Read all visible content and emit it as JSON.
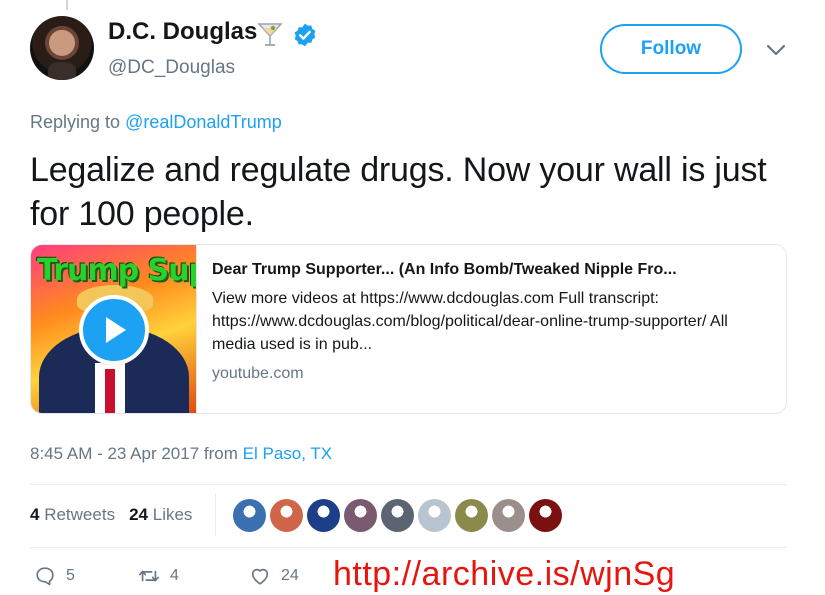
{
  "author": {
    "display_name": "D.C. Douglas",
    "handle": "@DC_Douglas",
    "emoji_icon": "cocktail-glass-icon",
    "verified_icon": "verified-badge-icon"
  },
  "header": {
    "follow_label": "Follow",
    "caret_icon": "chevron-down-icon"
  },
  "reply": {
    "prefix": "Replying to",
    "target": "@realDonaldTrump"
  },
  "tweet": {
    "text": "Legalize and regulate drugs. Now your wall is just for 100 people."
  },
  "card": {
    "thumbnail_text": "Trump Suppo",
    "title": "Dear Trump Supporter... (An Info Bomb/Tweaked Nipple Fro...",
    "description": "View more videos at https://www.dcdouglas.com Full transcript: https://www.dcdouglas.com/blog/political/dear-online-trump-supporter/ All media used is in pub...",
    "domain": "youtube.com",
    "play_icon": "play-icon"
  },
  "meta": {
    "time": "8:45 AM - 23 Apr 2017",
    "from_label": "from",
    "location": "El Paso, TX"
  },
  "stats": {
    "retweets_count": "4",
    "retweets_label": "Retweets",
    "likes_count": "24",
    "likes_label": "Likes"
  },
  "likers": [
    {
      "name": "liker-avatar-1",
      "color": "#3b6fb0"
    },
    {
      "name": "liker-avatar-2",
      "color": "#d0654a"
    },
    {
      "name": "liker-avatar-3",
      "color": "#1d3f8a"
    },
    {
      "name": "liker-avatar-4",
      "color": "#7a5a6e"
    },
    {
      "name": "liker-avatar-5",
      "color": "#5b6470"
    },
    {
      "name": "liker-avatar-6",
      "color": "#b8c4cf"
    },
    {
      "name": "liker-avatar-7",
      "color": "#8a8a4a"
    },
    {
      "name": "liker-avatar-8",
      "color": "#9a8f8a"
    },
    {
      "name": "liker-avatar-9",
      "color": "#7a1010"
    }
  ],
  "actions": {
    "reply_icon": "reply-icon",
    "reply_count": "5",
    "retweet_icon": "retweet-icon",
    "retweet_count": "4",
    "like_icon": "heart-icon",
    "like_count": "24"
  },
  "watermark": {
    "text": "http://archive.is/wjnSg"
  },
  "colors": {
    "accent": "#1da1f2",
    "secondary_text": "#657786",
    "watermark": "#e8150f"
  }
}
